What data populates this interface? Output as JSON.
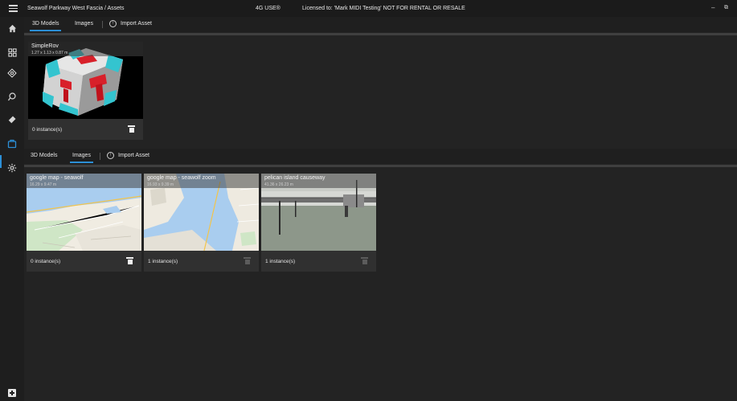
{
  "titlebar": {
    "title": "Seawolf Parkway West Fascia / Assets",
    "status": "4G USE®",
    "license": "Licensed to: 'Mark MIDI Testing' NOT FOR RENTAL OR RESALE",
    "minimize": "–",
    "restore": "⧉"
  },
  "models_section": {
    "tabs": [
      "3D Models",
      "Images"
    ],
    "active_tab": "3D Models",
    "import_label": "Import Asset",
    "cards": [
      {
        "title": "SimpleRov",
        "dims": "1.27 x 1.13 x 0.87 m",
        "count": "0 instance(s)",
        "delete_enabled": true
      }
    ]
  },
  "images_section": {
    "tabs": [
      "3D Models",
      "Images"
    ],
    "active_tab": "Images",
    "import_label": "Import Asset",
    "cards": [
      {
        "title": "google map - seawolf",
        "dims": "16.29 x 9.47 m",
        "count": "0 instance(s)",
        "delete_enabled": true
      },
      {
        "title": "google map - seawolf zoom",
        "dims": "16.93 x 9.39 m",
        "count": "1 instance(s)",
        "delete_enabled": false
      },
      {
        "title": "pelican island causeway",
        "dims": "41.36 x 26.23 m",
        "count": "1 instance(s)",
        "delete_enabled": false
      }
    ]
  },
  "rail": {
    "icons": [
      "home-icon",
      "dashboard-icon",
      "network-icon",
      "palette-icon",
      "eraser-icon",
      "assets-icon",
      "settings-icon"
    ],
    "active": "assets-icon",
    "bottom": "add-icon"
  },
  "colors": {
    "accent": "#2c8fd6",
    "background": "#232323",
    "bar": "#1f1f1f",
    "card": "#303030"
  }
}
